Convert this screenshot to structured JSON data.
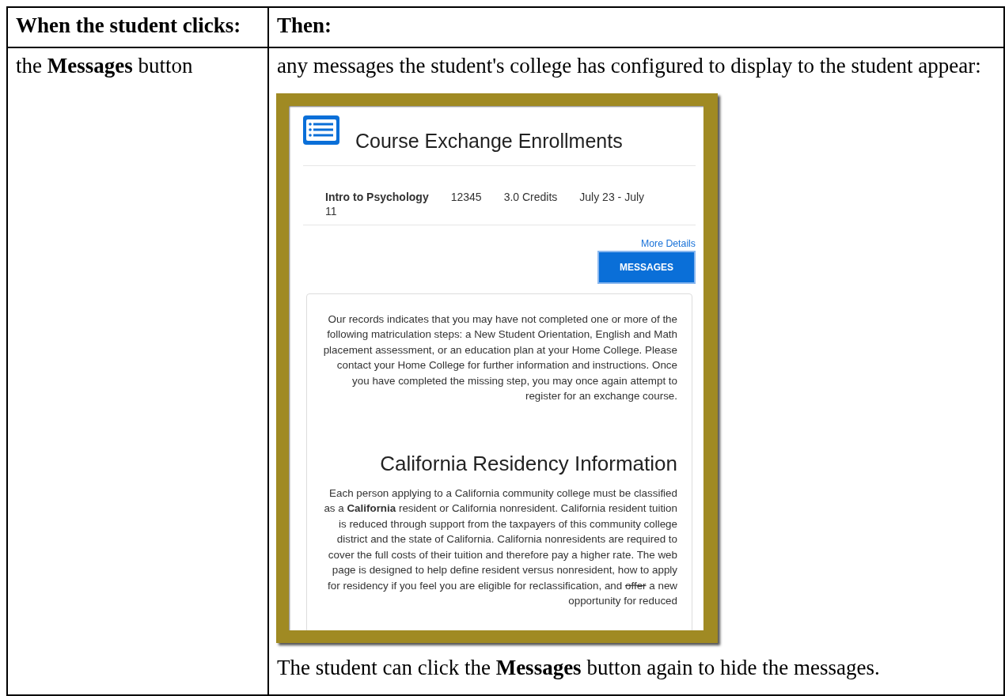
{
  "table": {
    "columns": [
      "When the student clicks:",
      "Then:"
    ],
    "rows": [
      {
        "trigger": "the **Messages** button",
        "description": "any messages the student's college has configured to display to the student appear:",
        "screenshot": {
          "title": "Course Exchange Enrollments",
          "course": {
            "name": "Intro to Psychology",
            "number": "12345",
            "credits": "3.0 Credits",
            "dates": "July 23 - July 11"
          },
          "link": "More Details",
          "button": "MESSAGES",
          "messages": [
            {
              "kind": "paragraph",
              "segments": [
                {
                  "kind": "plain",
                  "text": "Our records indicates that you may have not completed one or more of the following matriculation steps: a New Student Orientation, English and Math placement assessment, or an education plan at your Home College. Please contact your Home College for further information and instructions. Once you have completed the missing step, you may once again attempt to register for an exchange course."
                }
              ]
            },
            {
              "kind": "heading",
              "segments": [
                {
                  "kind": "plain",
                  "text": "California Residency Information"
                }
              ]
            },
            {
              "kind": "paragraph",
              "segments": [
                {
                  "kind": "plain",
                  "text": "Each person applying to a California community college must be classified as a "
                },
                {
                  "kind": "bold",
                  "text": "California"
                },
                {
                  "kind": "plain",
                  "text": " resident or California nonresident. California resident tuition is reduced through support from the taxpayers of this community college district and the state of California. California nonresidents are required to cover the full costs of their tuition and therefore pay a higher rate. The web page is designed to help define resident versus nonresident, how to apply for residency if you feel you are eligible for reclassification, and "
                },
                {
                  "kind": "strike",
                  "text": "offer"
                },
                {
                  "kind": "plain",
                  "text": " a new opportunity for reduced"
                }
              ]
            }
          ]
        },
        "note": "The student can click the **Messages** button again to hide the messages."
      }
    ]
  }
}
